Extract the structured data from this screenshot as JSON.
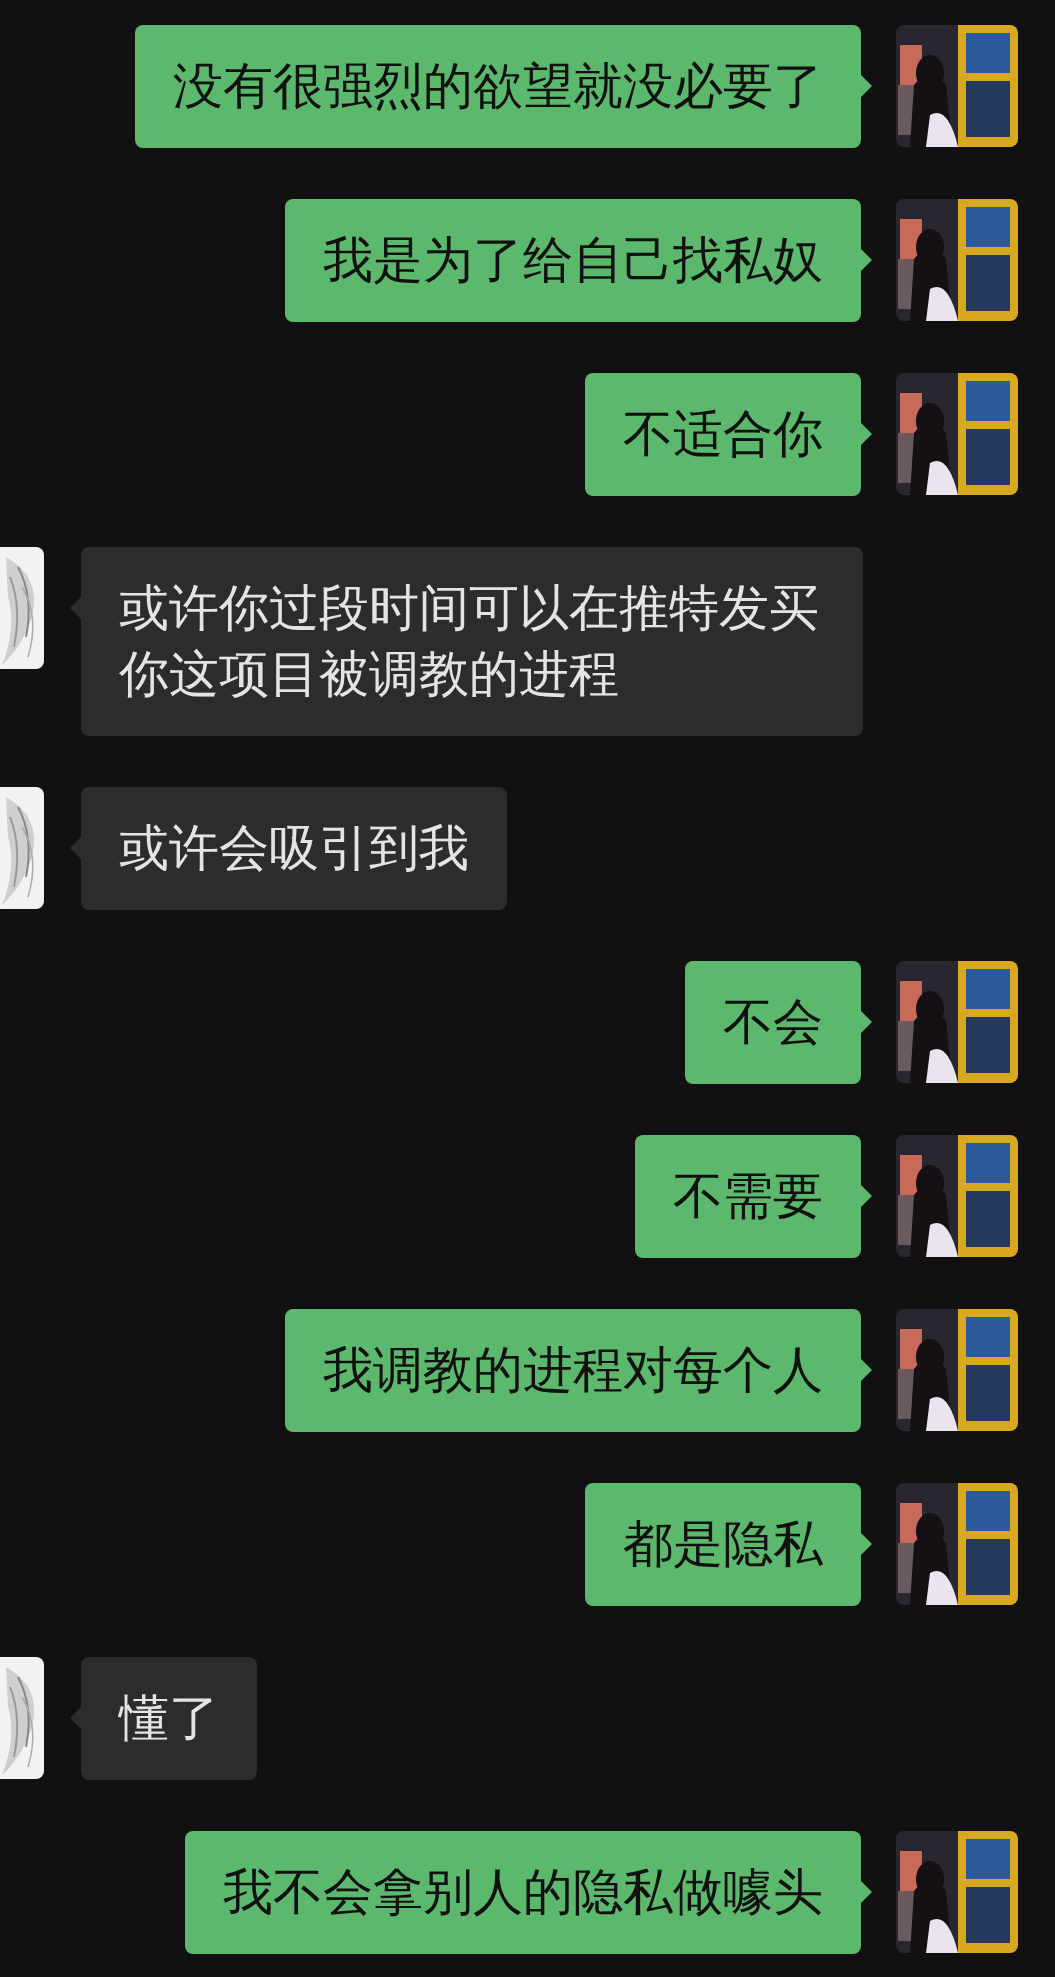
{
  "messages": [
    {
      "kind": "sent",
      "text": "没有很强烈的欲望就没必要了"
    },
    {
      "kind": "sent",
      "text": "我是为了给自己找私奴"
    },
    {
      "kind": "sent",
      "text": "不适合你"
    },
    {
      "kind": "received",
      "text": "或许你过段时间可以在推特发买你这项目被调教的进程"
    },
    {
      "kind": "received",
      "text": "或许会吸引到我"
    },
    {
      "kind": "sent",
      "text": "不会"
    },
    {
      "kind": "sent",
      "text": "不需要"
    },
    {
      "kind": "sent",
      "text": "我调教的进程对每个人"
    },
    {
      "kind": "sent",
      "text": "都是隐私"
    },
    {
      "kind": "received",
      "text": "懂了"
    },
    {
      "kind": "sent",
      "text": "我不会拿别人的隐私做噱头"
    }
  ]
}
